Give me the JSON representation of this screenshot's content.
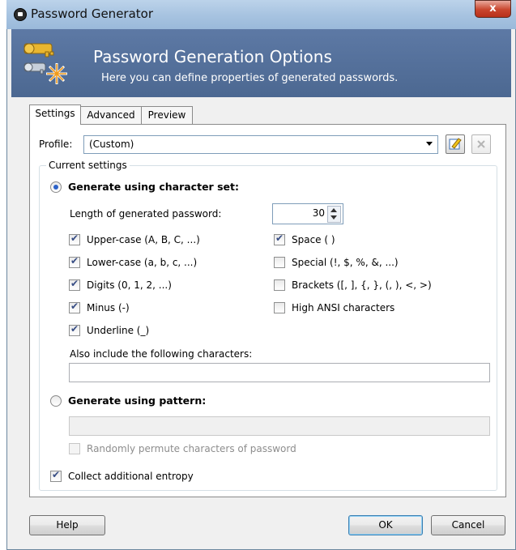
{
  "window": {
    "title": "Password Generator",
    "close_label": "x"
  },
  "banner": {
    "title": "Password Generation Options",
    "subtitle": "Here you can define properties of generated passwords."
  },
  "tabs": [
    {
      "label": "Settings",
      "active": true
    },
    {
      "label": "Advanced",
      "active": false
    },
    {
      "label": "Preview",
      "active": false
    }
  ],
  "profile": {
    "label": "Profile:",
    "value": "(Custom)"
  },
  "current_settings": {
    "group_title": "Current settings",
    "charset_radio": {
      "label": "Generate using character set:",
      "selected": true
    },
    "length_label": "Length of generated password:",
    "length_value": "30",
    "options": {
      "uppercase": {
        "label": "Upper-case (A, B, C, ...)",
        "checked": true
      },
      "lowercase": {
        "label": "Lower-case (a, b, c, ...)",
        "checked": true
      },
      "digits": {
        "label": "Digits (0, 1, 2, ...)",
        "checked": true
      },
      "minus": {
        "label": "Minus (-)",
        "checked": true
      },
      "underline": {
        "label": "Underline (_)",
        "checked": true
      },
      "space": {
        "label": "Space ( )",
        "checked": true
      },
      "special": {
        "label": "Special (!, $, %, &, ...)",
        "checked": false
      },
      "brackets": {
        "label": "Brackets ([, ], {, }, (, ), <, >)",
        "checked": false
      },
      "high_ansi": {
        "label": "High ANSI characters",
        "checked": false
      }
    },
    "also_include_label": "Also include the following characters:",
    "also_include_value": "",
    "pattern_radio": {
      "label": "Generate using pattern:",
      "selected": false
    },
    "pattern_value": "",
    "permute": {
      "label": "Randomly permute characters of password",
      "checked": false,
      "disabled": true
    },
    "entropy": {
      "label": "Collect additional entropy",
      "checked": true
    }
  },
  "buttons": {
    "help": "Help",
    "ok": "OK",
    "cancel": "Cancel"
  },
  "colors": {
    "banner": "#56729e",
    "accent": "#2c62c8",
    "close": "#c9452d"
  }
}
